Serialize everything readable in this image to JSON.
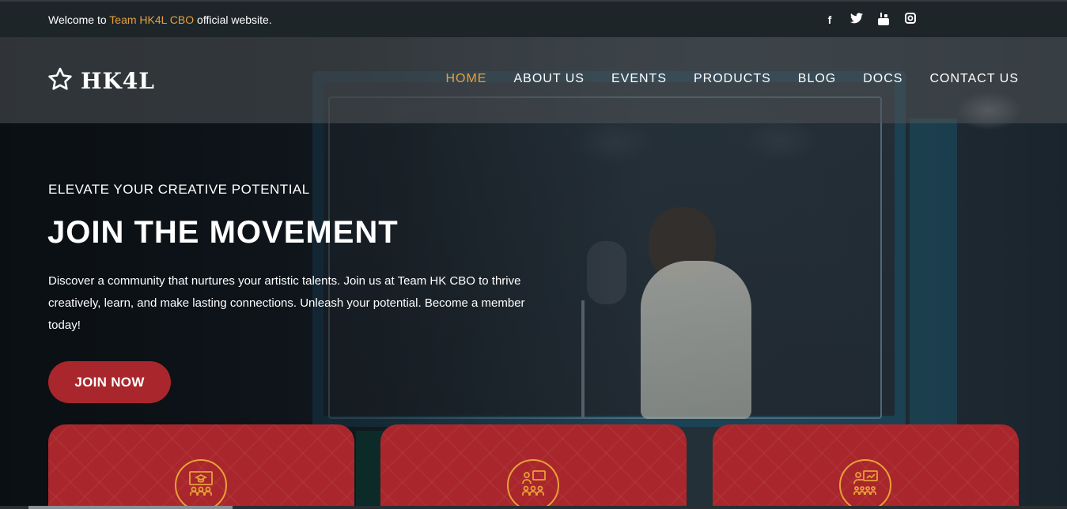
{
  "topbar": {
    "welcome_prefix": "Welcome to ",
    "welcome_accent": "Team HK4L CBO",
    "welcome_suffix": " official website.",
    "social": [
      {
        "icon": "facebook-icon",
        "glyph": "f"
      },
      {
        "icon": "twitter-icon",
        "glyph": "t"
      },
      {
        "icon": "youtube-icon",
        "glyph": "▶"
      },
      {
        "icon": "instagram-icon",
        "glyph": "◎"
      }
    ]
  },
  "header": {
    "logo_text": "HK4L",
    "nav": [
      {
        "label": "HOME",
        "active": true
      },
      {
        "label": "ABOUT US",
        "active": false
      },
      {
        "label": "EVENTS",
        "active": false
      },
      {
        "label": "PRODUCTS",
        "active": false
      },
      {
        "label": "BLOG",
        "active": false
      },
      {
        "label": "DOCS",
        "active": false
      },
      {
        "label": "CONTACT US",
        "active": false
      }
    ]
  },
  "hero": {
    "eyebrow": "ELEVATE YOUR CREATIVE POTENTIAL",
    "headline": "JOIN THE MOVEMENT",
    "lead": "Discover a community that nurtures your artistic talents. Join us at Team HK CBO to thrive creatively, learn, and make lasting connections. Unleash your potential. Become a member today!",
    "cta_label": "JOIN NOW"
  },
  "cards": [
    {
      "icon": "classroom-icon"
    },
    {
      "icon": "mentorship-group-icon"
    },
    {
      "icon": "presentation-audience-icon"
    }
  ],
  "colors": {
    "accent": "#e8a038",
    "brand_red": "#a9272c",
    "topbar_bg": "#1e2529"
  }
}
